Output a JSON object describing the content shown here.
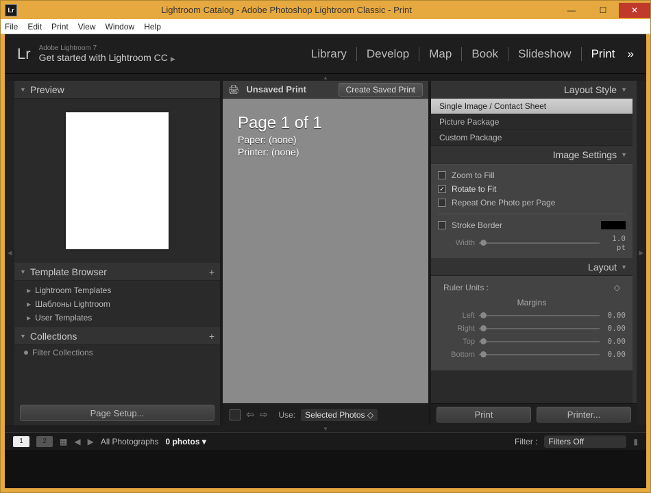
{
  "window": {
    "title": "Lightroom Catalog - Adobe Photoshop Lightroom Classic - Print",
    "appicon": "Lr"
  },
  "menus": [
    "File",
    "Edit",
    "Print",
    "View",
    "Window",
    "Help"
  ],
  "header": {
    "logo": "Lr",
    "sub": "Adobe Lightroom 7",
    "title": "Get started with Lightroom CC",
    "modules": [
      "Library",
      "Develop",
      "Map",
      "Book",
      "Slideshow",
      "Print"
    ],
    "active_module": "Print",
    "chevron": "»"
  },
  "left": {
    "preview_title": "Preview",
    "template_title": "Template Browser",
    "templates": [
      "Lightroom Templates",
      "Шаблоны Lightroom",
      "User Templates"
    ],
    "collections_title": "Collections",
    "filter_placeholder": "Filter Collections",
    "page_setup": "Page Setup..."
  },
  "center": {
    "unsaved": "Unsaved Print",
    "create_btn": "Create Saved Print",
    "page_of": "Page 1 of 1",
    "paper_line": "Paper: (none)",
    "printer_line": "Printer: (none)",
    "use_label": "Use:",
    "use_value": "Selected Photos"
  },
  "right": {
    "layout_style_title": "Layout Style",
    "layout_styles": [
      "Single Image / Contact Sheet",
      "Picture Package",
      "Custom Package"
    ],
    "image_settings_title": "Image Settings",
    "zoom_to_fill": "Zoom to Fill",
    "rotate_to_fit": "Rotate to Fit",
    "repeat_one": "Repeat One Photo per Page",
    "stroke_border": "Stroke Border",
    "width_label": "Width",
    "width_value": "1.0 pt",
    "layout_title": "Layout",
    "ruler_units": "Ruler Units :",
    "margins_title": "Margins",
    "margin_left": "Left",
    "margin_left_v": "0.00",
    "margin_right": "Right",
    "margin_right_v": "0.00",
    "margin_top": "Top",
    "margin_top_v": "0.00",
    "margin_bottom": "Bottom",
    "margin_bottom_v": "0.00",
    "print_btn": "Print",
    "printer_btn": "Printer..."
  },
  "filmstrip": {
    "view1": "1",
    "view2": "2",
    "source": "All Photographs",
    "count": "0 photos",
    "filter_label": "Filter :",
    "filter_value": "Filters Off"
  }
}
